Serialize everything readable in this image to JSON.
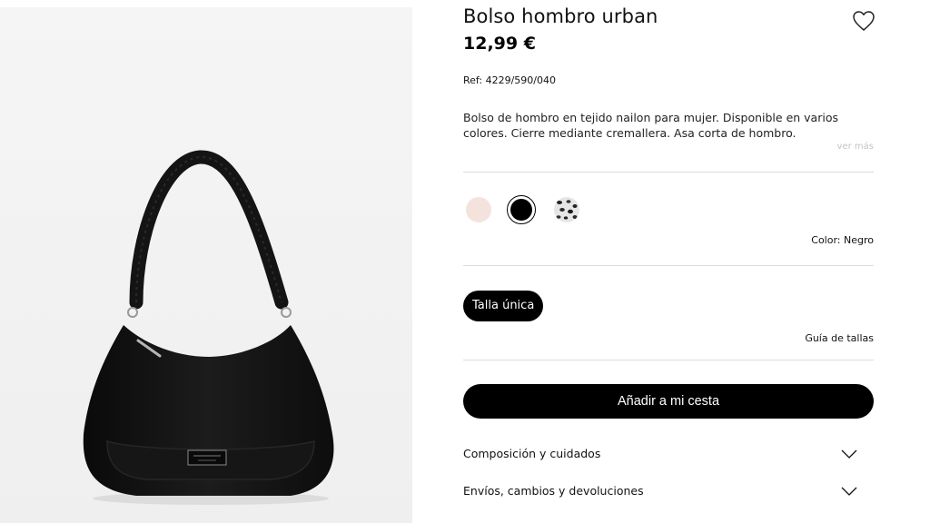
{
  "product": {
    "title": "Bolso hombro urban",
    "price": "12,99 €",
    "reference": "Ref: 4229/590/040",
    "description": "Bolso de hombro en tejido nailon para mujer. Disponible en varios colores. Cierre mediante cremallera. Asa corta de hombro.",
    "see_more_label": "ver más",
    "image_alt": "Bolso de hombro negro de nailon con asa corta"
  },
  "colors": {
    "options": [
      {
        "name": "beige",
        "hex": "#f4e3dc"
      },
      {
        "name": "negro",
        "hex": "#000000",
        "selected": true
      },
      {
        "name": "leopardo",
        "hex": "#d9d9d9"
      }
    ],
    "label_prefix": "Color:",
    "selected_name": "Negro"
  },
  "size": {
    "selected_label": "Talla única",
    "guide_label": "Guía de tallas"
  },
  "cart": {
    "add_label": "Añadir a mi cesta"
  },
  "accordions": [
    {
      "label": "Composición y cuidados",
      "icon": "chevron-down-icon"
    },
    {
      "label": "Envíos, cambios y devoluciones",
      "icon": "chevron-down-icon"
    }
  ],
  "icons": {
    "favorite": "heart-outline-icon"
  }
}
